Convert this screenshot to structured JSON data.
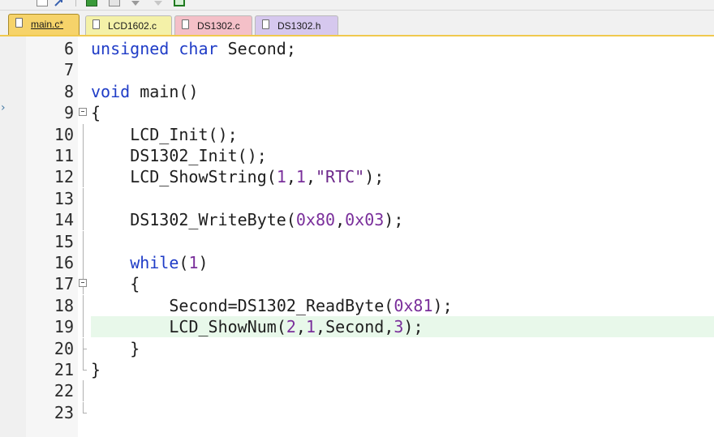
{
  "tabs": [
    {
      "label": "main.c*",
      "color": "#f6d36a",
      "active": true
    },
    {
      "label": "LCD1602.c",
      "color": "#f4f1a8",
      "active": false
    },
    {
      "label": "DS1302.c",
      "color": "#f4c0c8",
      "active": false
    },
    {
      "label": "DS1302.h",
      "color": "#d6c8ee",
      "active": false
    }
  ],
  "editor": {
    "highlighted_line": "19",
    "lines": [
      {
        "num": "6",
        "text": "unsigned char Second;"
      },
      {
        "num": "7",
        "text": ""
      },
      {
        "num": "8",
        "text": "void main()"
      },
      {
        "num": "9",
        "text": "{"
      },
      {
        "num": "10",
        "text": "    LCD_Init();"
      },
      {
        "num": "11",
        "text": "    DS1302_Init();"
      },
      {
        "num": "12",
        "text": "    LCD_ShowString(1,1,\"RTC\");"
      },
      {
        "num": "13",
        "text": ""
      },
      {
        "num": "14",
        "text": "    DS1302_WriteByte(0x80,0x03);"
      },
      {
        "num": "15",
        "text": ""
      },
      {
        "num": "16",
        "text": "    while(1)"
      },
      {
        "num": "17",
        "text": "    {"
      },
      {
        "num": "18",
        "text": "        Second=DS1302_ReadByte(0x81);"
      },
      {
        "num": "19",
        "text": "        LCD_ShowNum(2,1,Second,3);"
      },
      {
        "num": "20",
        "text": "    }"
      },
      {
        "num": "21",
        "text": "}"
      },
      {
        "num": "22",
        "text": ""
      },
      {
        "num": "23",
        "text": ""
      }
    ]
  },
  "colors": {
    "keyword": "#1f3cc7",
    "number": "#7a2f9b",
    "string": "#6e2a8c",
    "highlight": "#e8f8ea",
    "tab_underline": "#f0c94e"
  },
  "icons": [
    "build-icon",
    "rebuild-icon",
    "download-icon",
    "options-icon",
    "debug-icon"
  ]
}
